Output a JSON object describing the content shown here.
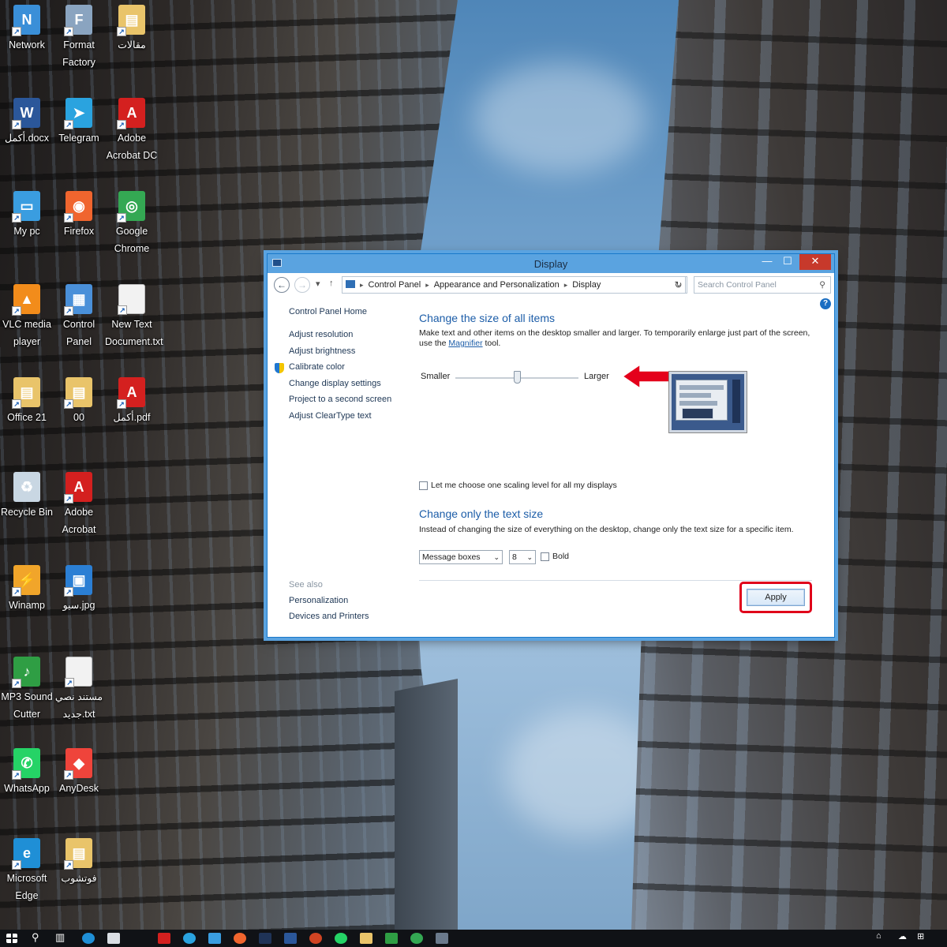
{
  "desktop": {
    "icons": [
      {
        "label": "Network",
        "color": "#3a8fd8",
        "glyph": "N",
        "col": 0,
        "row": 0
      },
      {
        "label": "Format Factory",
        "color": "#8aa4c0",
        "glyph": "F",
        "col": 1,
        "row": 0
      },
      {
        "label": "مقالات",
        "color": "#e9c46a",
        "glyph": "▤",
        "col": 2,
        "row": 0
      },
      {
        "label": "أكمل.docx",
        "color": "#2b579a",
        "glyph": "W",
        "col": 0,
        "row": 1
      },
      {
        "label": "Telegram",
        "color": "#2aa3df",
        "glyph": "➤",
        "col": 1,
        "row": 1
      },
      {
        "label": "Adobe Acrobat DC",
        "color": "#d4201f",
        "glyph": "A",
        "col": 2,
        "row": 1
      },
      {
        "label": "My pc",
        "color": "#3a9de0",
        "glyph": "▭",
        "col": 0,
        "row": 2
      },
      {
        "label": "Firefox",
        "color": "#f0652e",
        "glyph": "◉",
        "col": 1,
        "row": 2
      },
      {
        "label": "Google Chrome",
        "color": "#34a853",
        "glyph": "◎",
        "col": 2,
        "row": 2
      },
      {
        "label": "VLC media player",
        "color": "#f28c1b",
        "glyph": "▲",
        "col": 0,
        "row": 3
      },
      {
        "label": "Control Panel",
        "color": "#4a90d9",
        "glyph": "▦",
        "col": 1,
        "row": 3
      },
      {
        "label": "New Text Document.txt",
        "color": "#f2f2f2",
        "glyph": "",
        "col": 2,
        "row": 3
      },
      {
        "label": "Office 21",
        "color": "#e9c46a",
        "glyph": "▤",
        "col": 0,
        "row": 4
      },
      {
        "label": "00",
        "color": "#e9c46a",
        "glyph": "▤",
        "col": 1,
        "row": 4
      },
      {
        "label": "أكمل.pdf",
        "color": "#d4201f",
        "glyph": "A",
        "col": 2,
        "row": 4
      },
      {
        "label": "Recycle Bin",
        "color": "#c9d7e3",
        "glyph": "♻",
        "col": 0,
        "row": 5
      },
      {
        "label": "Adobe Acrobat",
        "color": "#d4201f",
        "glyph": "A",
        "col": 1,
        "row": 5
      },
      {
        "label": "Winamp",
        "color": "#f1a52a",
        "glyph": "⚡",
        "col": 0,
        "row": 6
      },
      {
        "label": "سيو.jpg",
        "color": "#2b7fd4",
        "glyph": "▣",
        "col": 1,
        "row": 6
      },
      {
        "label": "MP3 Sound Cutter",
        "color": "#2f9e44",
        "glyph": "♪",
        "col": 0,
        "row": 7
      },
      {
        "label": "مستند نصي جديد.txt",
        "color": "#f2f2f2",
        "glyph": "",
        "col": 1,
        "row": 7
      },
      {
        "label": "WhatsApp",
        "color": "#25d366",
        "glyph": "✆",
        "col": 0,
        "row": 8
      },
      {
        "label": "AnyDesk",
        "color": "#ef443b",
        "glyph": "◆",
        "col": 1,
        "row": 8
      },
      {
        "label": "Microsoft Edge",
        "color": "#1f8fd6",
        "glyph": "e",
        "col": 0,
        "row": 9
      },
      {
        "label": "فوتشوب",
        "color": "#e9c46a",
        "glyph": "▤",
        "col": 1,
        "row": 9
      }
    ]
  },
  "window": {
    "title": "Display",
    "address": {
      "crumbs": [
        "Control Panel",
        "Appearance and Personalization",
        "Display"
      ],
      "search_placeholder": "Search Control Panel"
    },
    "leftnav": {
      "home": "Control Panel Home",
      "links": [
        "Adjust resolution",
        "Adjust brightness",
        "Calibrate color",
        "Change display settings",
        "Project to a second screen",
        "Adjust ClearType text"
      ],
      "see_also_heading": "See also",
      "see_also": [
        "Personalization",
        "Devices and Printers"
      ]
    },
    "main": {
      "heading1": "Change the size of all items",
      "desc1_a": "Make text and other items on the desktop smaller and larger. To temporarily enlarge just part of the screen,",
      "desc1_b": "use the",
      "desc1_link": "Magnifier",
      "desc1_c": "tool.",
      "slider_smaller": "Smaller",
      "slider_larger": "Larger",
      "slider_level": 0.5,
      "checkbox_label": "Let me choose one scaling level for all my displays",
      "heading2": "Change only the text size",
      "desc2": "Instead of changing the size of everything on the desktop, change only the text size for a specific item.",
      "item_select": "Message boxes",
      "size_select": "8",
      "bold_label": "Bold",
      "apply_label": "Apply"
    }
  },
  "colors": {
    "highlight": "#e0001a",
    "link": "#1c5da8"
  }
}
